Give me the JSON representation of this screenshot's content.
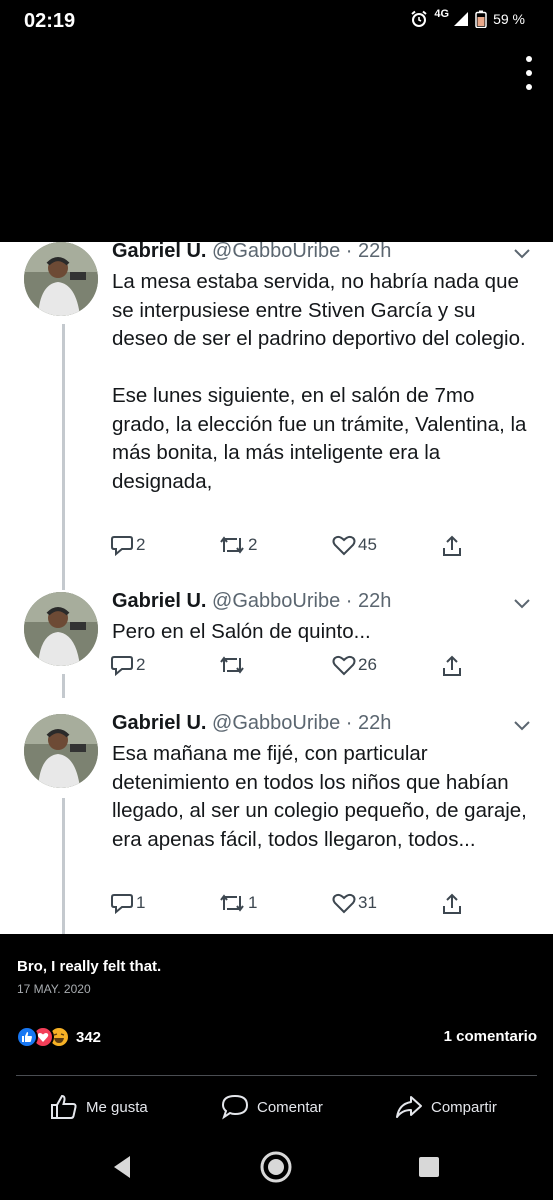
{
  "status_bar": {
    "time": "02:19",
    "network": "4G",
    "battery": "59 %",
    "icons": [
      "alarm-icon",
      "signal-icon",
      "battery-icon"
    ]
  },
  "top_menu": {
    "icon": "more-vertical-icon"
  },
  "tweets": [
    {
      "name": "Gabriel U.",
      "handle": "@GabboUribe · 22h",
      "text": "La mesa estaba servida, no habría nada que se interpusiese entre Stiven García y su deseo de ser el padrino deportivo del colegio.\n\nEse lunes siguiente, en el salón de 7mo grado, la elección fue un trámite, Valentina, la más bonita, la más inteligente era la designada,",
      "replies": "2",
      "retweets": "2",
      "likes": "45"
    },
    {
      "name": "Gabriel U.",
      "handle": "@GabboUribe · 22h",
      "text": "Pero en el Salón de quinto...",
      "replies": "2",
      "retweets": "",
      "likes": "26"
    },
    {
      "name": "Gabriel U.",
      "handle": "@GabboUribe · 22h",
      "text": "Esa mañana me fijé, con particular detenimiento en todos los niños que habían llegado, al ser un colegio pequeño, de garaje, era apenas fácil, todos llegaron, todos...",
      "replies": "1",
      "retweets": "1",
      "likes": "31"
    }
  ],
  "post": {
    "caption": "Bro, I really felt that.",
    "date": "17 MAY. 2020",
    "reaction_count": "342",
    "reaction_icons": [
      "like-icon",
      "love-icon",
      "haha-icon"
    ],
    "comment_count": "1 comentario"
  },
  "actions": {
    "like": "Me gusta",
    "comment": "Comentar",
    "share": "Compartir"
  },
  "nav": {
    "icons": [
      "back-icon",
      "home-icon",
      "recents-icon"
    ]
  },
  "colors": {
    "background": "#000000",
    "tweet_background": "#ffffff",
    "like_blue": "#1877f2",
    "love_red": "#f33e58",
    "haha_yellow": "#f7b125"
  }
}
